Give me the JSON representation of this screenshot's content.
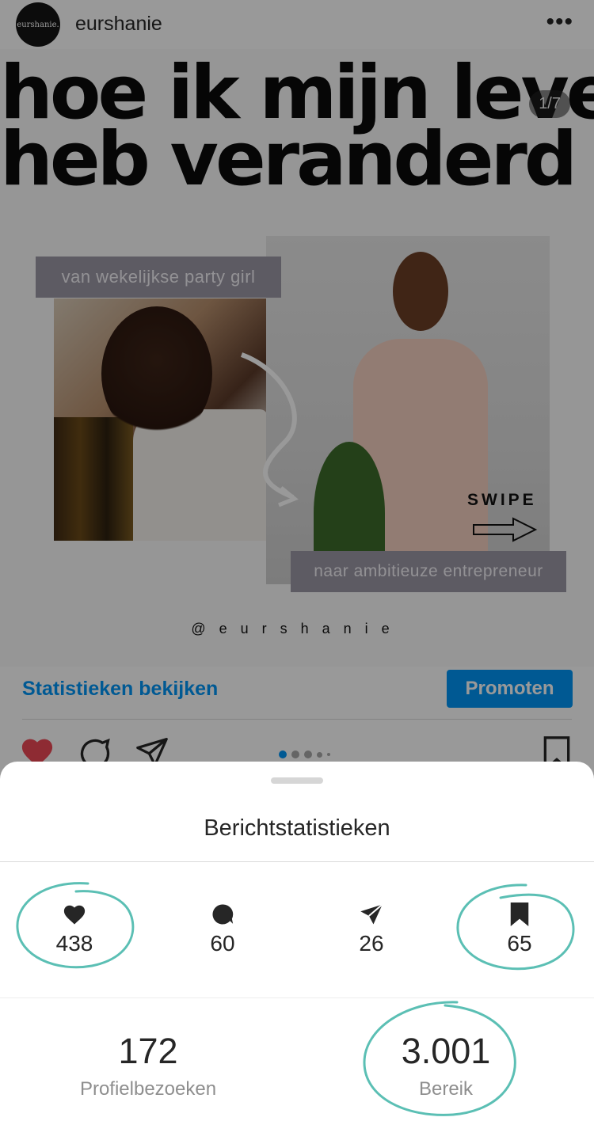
{
  "post": {
    "avatar_text": "eurshanie.",
    "username": "eurshanie",
    "more_icon": "more-horizontal-icon",
    "headline_line1": "hoe ik mijn leven",
    "headline_line2": "heb veranderd",
    "slide_counter": "1/7",
    "caption_top": "van wekelijkse party girl",
    "caption_bottom": "naar ambitieuze entrepreneur",
    "swipe_label": "SWIPE",
    "handle": "@eurshanie",
    "view_insights": "Statistieken bekijken",
    "promote": "Promoten",
    "carousel": {
      "total_dots": 5,
      "active_index": 0
    }
  },
  "sheet": {
    "title": "Berichtstatistieken",
    "stats": [
      {
        "icon": "heart-icon",
        "value": "438"
      },
      {
        "icon": "comment-icon",
        "value": "60"
      },
      {
        "icon": "share-icon",
        "value": "26"
      },
      {
        "icon": "bookmark-icon",
        "value": "65"
      }
    ],
    "profile_visits": {
      "value": "172",
      "label": "Profielbezoeken"
    },
    "reach": {
      "value": "3.001",
      "label": "Bereik"
    }
  },
  "colors": {
    "accent_blue": "#0095f6",
    "annotation_teal": "#5bbfb4",
    "like_red": "#ed4956"
  }
}
